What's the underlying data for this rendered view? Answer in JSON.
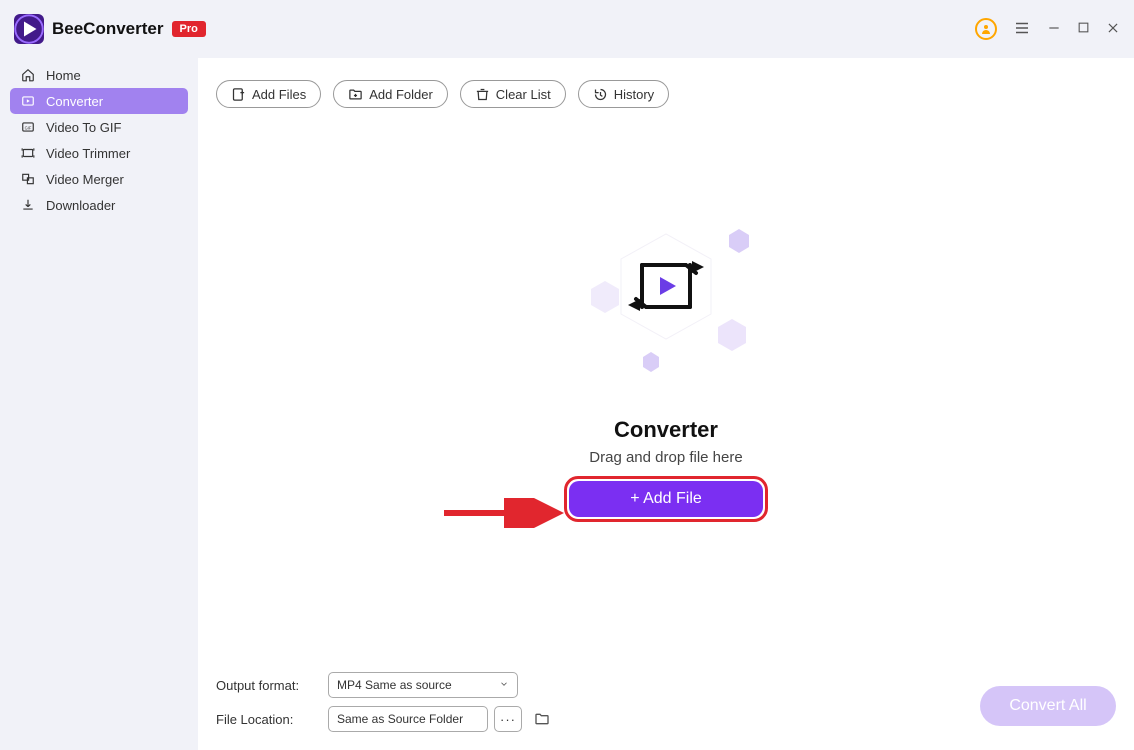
{
  "app": {
    "title": "BeeConverter",
    "badge": "Pro"
  },
  "sidebar": {
    "items": [
      {
        "label": "Home"
      },
      {
        "label": "Converter"
      },
      {
        "label": "Video To GIF"
      },
      {
        "label": "Video Trimmer"
      },
      {
        "label": "Video Merger"
      },
      {
        "label": "Downloader"
      }
    ]
  },
  "toolbar": {
    "add_files": "Add Files",
    "add_folder": "Add Folder",
    "clear_list": "Clear List",
    "history": "History"
  },
  "center": {
    "heading": "Converter",
    "subtext": "Drag and drop file here",
    "add_file_label": "+ Add File"
  },
  "footer": {
    "output_label": "Output format:",
    "output_value": "MP4 Same as source",
    "location_label": "File Location:",
    "location_value": "Same as Source Folder",
    "more": "···",
    "convert_all": "Convert All"
  }
}
